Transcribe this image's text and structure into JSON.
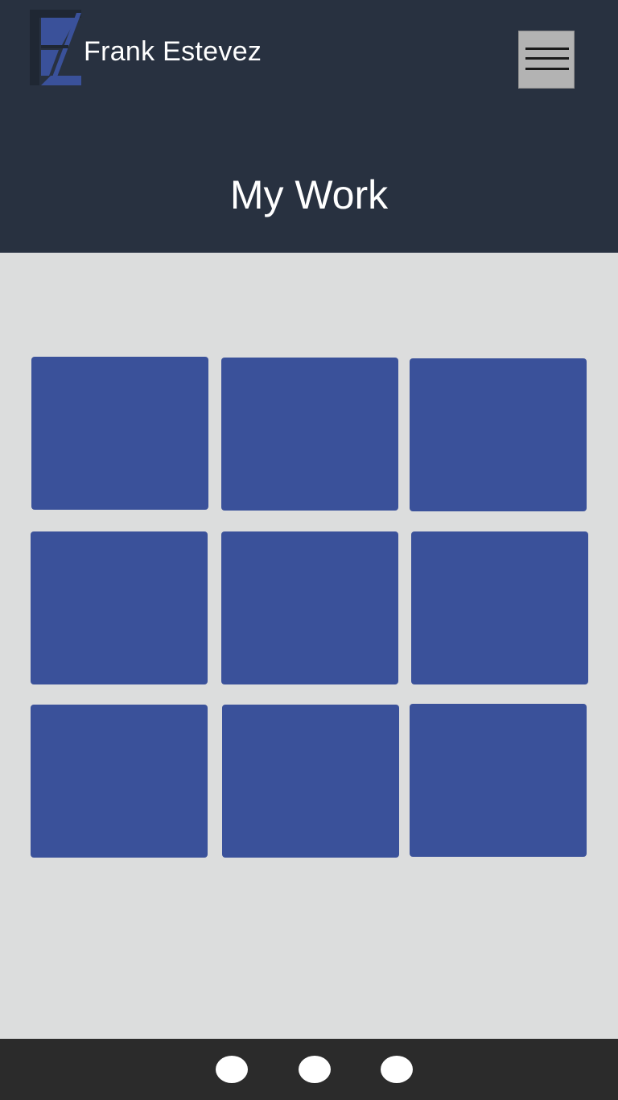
{
  "header": {
    "brand_name": "Frank Estevez",
    "logo_icon": "fe-monogram-logo-icon",
    "menu_icon": "hamburger-menu-icon",
    "page_title": "My Work"
  },
  "portfolio": {
    "tile_count": 9
  },
  "footer": {
    "social_links": [
      "social-link-1",
      "social-link-2",
      "social-link-3"
    ]
  },
  "colors": {
    "header_bg": "#283140",
    "content_bg": "#dcdddd",
    "tile": "#3a519a",
    "footer_bg": "#2b2b2b",
    "menu_button_bg": "#b3b3b3"
  }
}
